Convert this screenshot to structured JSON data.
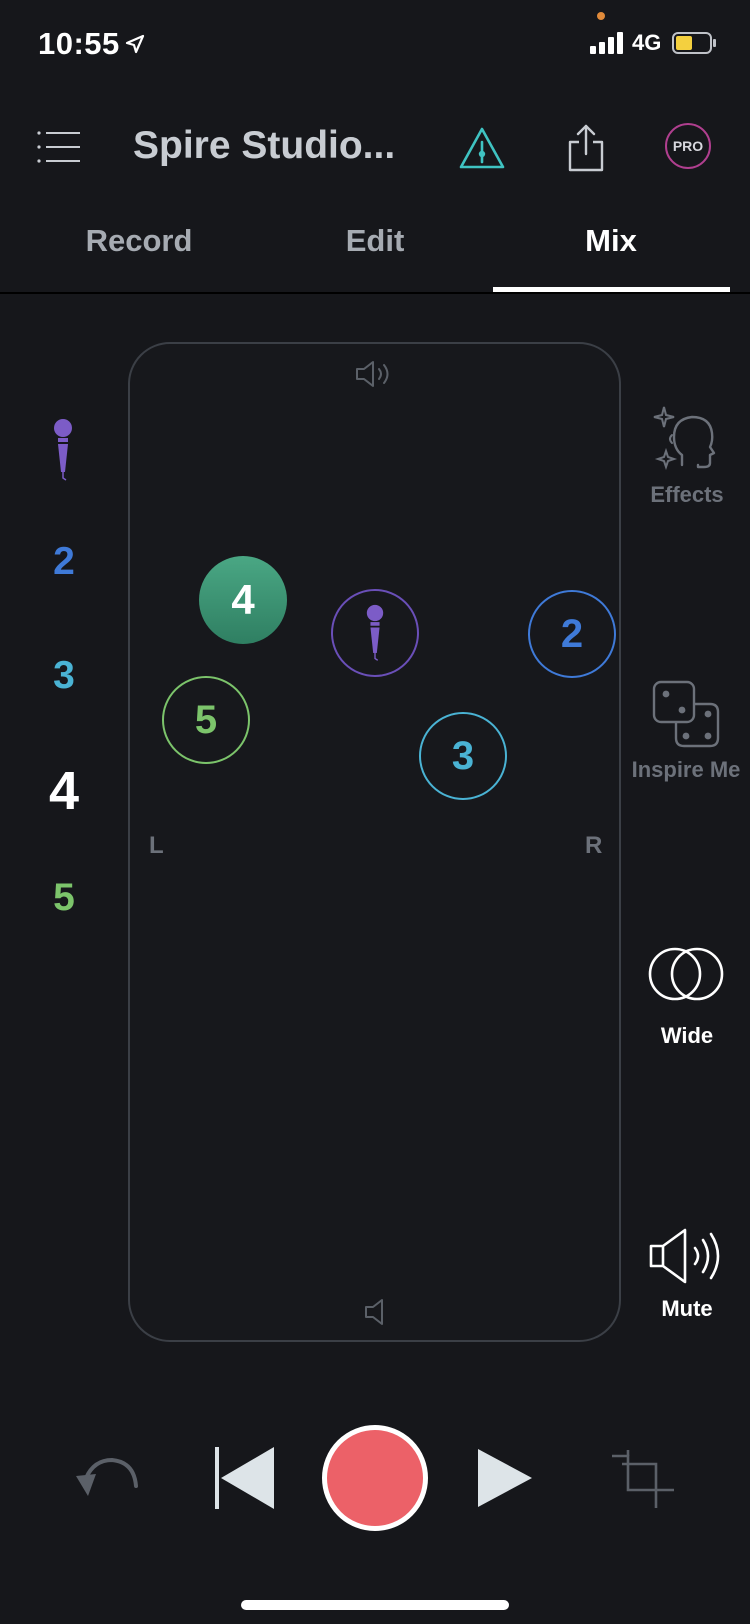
{
  "status_bar": {
    "time": "10:55",
    "network": "4G"
  },
  "header": {
    "title": "Spire Studio...",
    "pro_badge": "PRO"
  },
  "tabs": [
    {
      "label": "Record",
      "active": false
    },
    {
      "label": "Edit",
      "active": false
    },
    {
      "label": "Mix",
      "active": true
    }
  ],
  "tracks": [
    {
      "label": "",
      "icon": "microphone-icon",
      "color": "#7c5cc7"
    },
    {
      "label": "2",
      "color": "#3f7ad8"
    },
    {
      "label": "3",
      "color": "#4ab3d4"
    },
    {
      "label": "4",
      "color": "#ffffff"
    },
    {
      "label": "5",
      "color": "#7cc46b"
    }
  ],
  "pan_area": {
    "left_label": "L",
    "right_label": "R",
    "top_icon": "speaker-loud-icon",
    "bottom_icon": "speaker-quiet-icon"
  },
  "nodes": [
    {
      "label": "4",
      "color": "#3f9a76",
      "style": "filled"
    },
    {
      "label": "",
      "icon": "microphone-icon",
      "color": "#6a4fb8",
      "style": "outline"
    },
    {
      "label": "2",
      "color": "#3f7ad8",
      "style": "outline"
    },
    {
      "label": "5",
      "color": "#7cc46b",
      "style": "outline"
    },
    {
      "label": "3",
      "color": "#4ab3d4",
      "style": "outline"
    }
  ],
  "tools": {
    "effects": {
      "label": "Effects",
      "icon": "effects-face-icon",
      "enabled": false
    },
    "inspire": {
      "label": "Inspire Me",
      "icon": "dice-icon",
      "enabled": false
    },
    "wide": {
      "label": "Wide",
      "icon": "wide-circles-icon",
      "enabled": true
    },
    "mute": {
      "label": "Mute",
      "icon": "speaker-icon",
      "enabled": true
    }
  },
  "transport": {
    "undo_icon": "undo-icon",
    "rewind_icon": "skip-back-icon",
    "record_color": "#ec6168",
    "play_icon": "play-icon",
    "crop_icon": "crop-icon"
  }
}
